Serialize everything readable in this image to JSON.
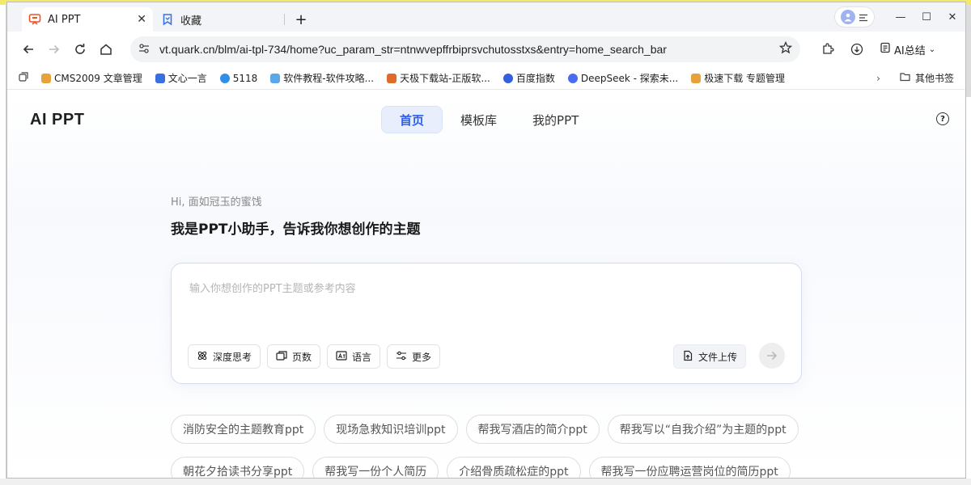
{
  "tabs": [
    {
      "label": "AI PPT",
      "close": "✕",
      "icon": "ppt-icon",
      "color": "#e8542c"
    },
    {
      "label": "收藏",
      "icon": "bookmark-icon",
      "color": "#3b72e6"
    }
  ],
  "new_tab": "+",
  "window": {
    "minimize": "—",
    "maximize": "☐",
    "close": "✕"
  },
  "address": {
    "url": "vt.quark.cn/blm/ai-tpl-734/home?uc_param_str=ntnwvepffrbiprsvchutosstxs&entry=home_search_bar",
    "ai_summary": "AI总结"
  },
  "bookmarks": [
    {
      "label": "CMS2009 文章管理",
      "color": "#e8a23c"
    },
    {
      "label": "文心一言",
      "color": "#3a6fe0"
    },
    {
      "label": "5118",
      "color": "#2f8fe8"
    },
    {
      "label": "软件教程-软件攻略...",
      "color": "#5aa8e8"
    },
    {
      "label": "天极下载站-正版软...",
      "color": "#e06a2a"
    },
    {
      "label": "百度指数",
      "color": "#3460e0"
    },
    {
      "label": "DeepSeek - 探索未...",
      "color": "#4a6cf0"
    },
    {
      "label": "极速下载 专题管理",
      "color": "#e8a23c"
    }
  ],
  "other_bookmarks": "其他书签",
  "page": {
    "logo": "AI PPT",
    "nav": [
      "首页",
      "模板库",
      "我的PPT"
    ],
    "help": "?",
    "greeting": "Hi, 面如冠玉的蜜饯",
    "headline": "我是PPT小助手，告诉我你想创作的主题",
    "input_placeholder": "输入你想创作的PPT主题或参考内容",
    "tools": [
      "深度思考",
      "页数",
      "语言",
      "更多"
    ],
    "upload": "文件上传",
    "suggestions_row1": [
      "消防安全的主题教育ppt",
      "现场急救知识培训ppt",
      "帮我写酒店的简介ppt",
      "帮我写以“自我介绍”为主题的ppt"
    ],
    "suggestions_row2": [
      "朝花夕拾读书分享ppt",
      "帮我写一份个人简历",
      "介绍骨质疏松症的ppt",
      "帮我写一份应聘运营岗位的简历ppt"
    ]
  },
  "colors": {
    "accent": "#2f5fe8",
    "accent_bg": "#e8eefc"
  }
}
